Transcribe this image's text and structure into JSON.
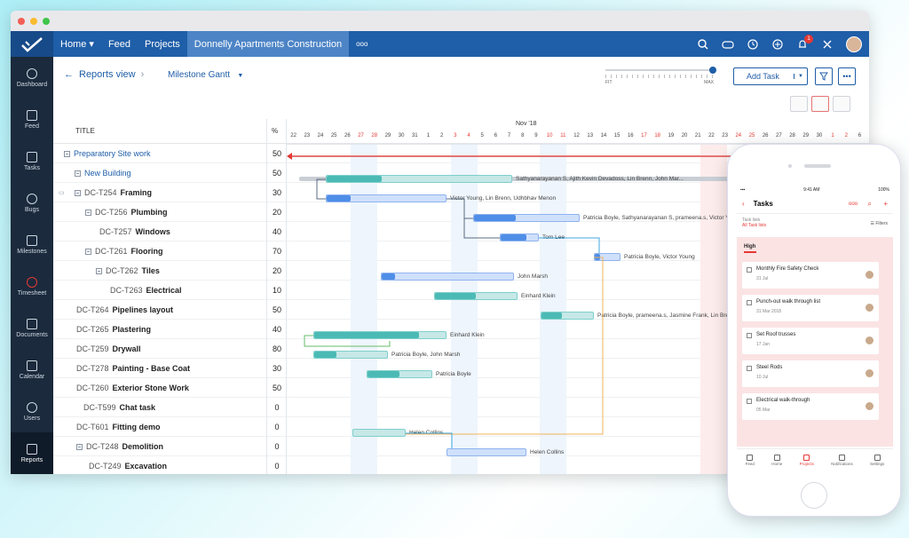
{
  "nav": {
    "items": [
      "Home",
      "Feed",
      "Projects"
    ],
    "home_caret": "▾",
    "project": "Donnelly Apartments Construction",
    "more": "ooo",
    "badge": "1"
  },
  "sidebar": [
    "Dashboard",
    "Feed",
    "Tasks",
    "Bugs",
    "Milestones",
    "Timesheet",
    "Documents",
    "Calendar",
    "Users",
    "Reports"
  ],
  "toolbar": {
    "back": "Reports view",
    "view": "Milestone Gantt",
    "fit": "FIT",
    "max": "MAX",
    "add_task": "Add Task",
    "more": "•••"
  },
  "columns": {
    "title": "TITLE",
    "pct": "%",
    "month": "Nov '18"
  },
  "days": [
    "22",
    "23",
    "24",
    "25",
    "26",
    "27",
    "28",
    "29",
    "30",
    "31",
    "1",
    "2",
    "3",
    "4",
    "5",
    "6",
    "7",
    "8",
    "9",
    "10",
    "11",
    "12",
    "13",
    "14",
    "15",
    "16",
    "17",
    "18",
    "19",
    "20",
    "21",
    "22",
    "23",
    "24",
    "25",
    "26",
    "27",
    "28",
    "29",
    "30",
    "1",
    "2",
    "6"
  ],
  "rows": [
    {
      "title": "Preparatory Site work",
      "pct": "50"
    },
    {
      "title": "New Building",
      "pct": "50"
    },
    {
      "id": "DC-T254",
      "title": "Framing",
      "pct": "30"
    },
    {
      "id": "DC-T256",
      "title": "Plumbing",
      "pct": "20"
    },
    {
      "id": "DC-T257",
      "title": "Windows",
      "pct": "40"
    },
    {
      "id": "DC-T261",
      "title": "Flooring",
      "pct": "70"
    },
    {
      "id": "DC-T262",
      "title": "Tiles",
      "pct": "20"
    },
    {
      "id": "DC-T263",
      "title": "Electrical",
      "pct": "10"
    },
    {
      "id": "DC-T264",
      "title": "Pipelines layout",
      "pct": "50"
    },
    {
      "id": "DC-T265",
      "title": "Plastering",
      "pct": "40"
    },
    {
      "id": "DC-T259",
      "title": "Drywall",
      "pct": "80"
    },
    {
      "id": "DC-T278",
      "title": "Painting - Base Coat",
      "pct": "30"
    },
    {
      "id": "DC-T260",
      "title": "Exterior Stone Work",
      "pct": "50"
    },
    {
      "id": "DC-T599",
      "title": "Chat task",
      "pct": "0"
    },
    {
      "id": "DC-T601",
      "title": "Fitting demo",
      "pct": "0"
    },
    {
      "id": "DC-T248",
      "title": "Demolition",
      "pct": "0"
    },
    {
      "id": "DC-T249",
      "title": "Excavation",
      "pct": "0"
    }
  ],
  "bars": [
    {
      "label": "Sathyanarayanan S, Ajith Kevin Devadoss, Lin Brenn, John Mar..."
    },
    {
      "label": "Victor Young, Lin Brenn, Udhbhav Menon"
    },
    {
      "label": "Patricia Boyle, Sathyanarayanan S, prameena.s, Victor Young"
    },
    {
      "label": "Tom Lee"
    },
    {
      "label": "Patricia Boyle, Victor Young"
    },
    {
      "label": "John Marsh"
    },
    {
      "label": "Einhard Klein"
    },
    {
      "label": "Patricia Boyle, prameena.s, Jasmine Frank, Lin Brenn"
    },
    {
      "label": "Einhard Klein"
    },
    {
      "label": "Patricia Boyle, John Marsh"
    },
    {
      "label": "Patricia Boyle"
    },
    {
      "label": "Helen Collins"
    },
    {
      "label": "Helen Collins"
    }
  ],
  "mobile": {
    "time": "9:41 AM",
    "battery": "100%",
    "title": "Tasks",
    "more": "ooo",
    "task_lists": "Task lists",
    "all_lists": "All Task lists",
    "filters": "Filters",
    "group": "High",
    "tasks": [
      {
        "name": "Monthly Fire Safety Check",
        "date": "31 Jul"
      },
      {
        "name": "Punch-out walk through list",
        "date": "31 Mar 2018"
      },
      {
        "name": "Set Roof trusses",
        "date": "17 Jan"
      },
      {
        "name": "Steel Rods",
        "date": "10 Jul"
      },
      {
        "name": "Electrical walk-through",
        "date": "05 Mar"
      }
    ],
    "tabs": [
      "Feed",
      "Home",
      "Projects",
      "Notifications",
      "Settings"
    ]
  }
}
